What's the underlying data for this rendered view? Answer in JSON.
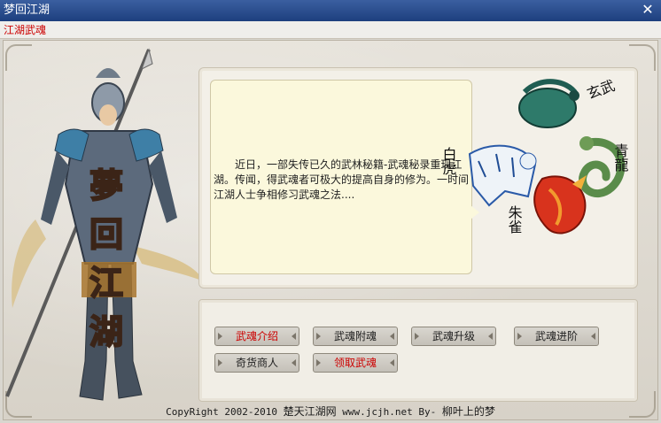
{
  "window": {
    "title": "梦回江湖",
    "close_label": "✕"
  },
  "tabs": [
    {
      "label": "江湖武魂"
    }
  ],
  "hero": {
    "title_chars": [
      "夢",
      "回",
      "江",
      "湖"
    ]
  },
  "story": {
    "text": "近日，一部失传已久的武林秘籍-武魂秘录重现江湖。传闻，得武魂者可极大的提高自身的修为。一时间江湖人士争相修习武魂之法...."
  },
  "beasts": {
    "labels": [
      "玄武",
      "青龍",
      "白虎",
      "朱雀"
    ]
  },
  "buttons": [
    {
      "label": "武魂介绍",
      "style": "red"
    },
    {
      "label": "武魂附魂",
      "style": "normal"
    },
    {
      "label": "武魂升级",
      "style": "normal"
    },
    {
      "label": "武魂进阶",
      "style": "normal"
    },
    {
      "label": "奇货商人",
      "style": "normal"
    },
    {
      "label": "领取武魂",
      "style": "red"
    }
  ],
  "footer": {
    "copyright": "CopyRight 2002-2010",
    "site_name": "楚天江湖网",
    "url": "www.jcjh.net",
    "by": "By-",
    "author": "柳叶上的梦"
  },
  "colors": {
    "titlebar": "#1d3f7e",
    "tab_text": "#cc0000",
    "highlight_button_text": "#cc0000"
  }
}
